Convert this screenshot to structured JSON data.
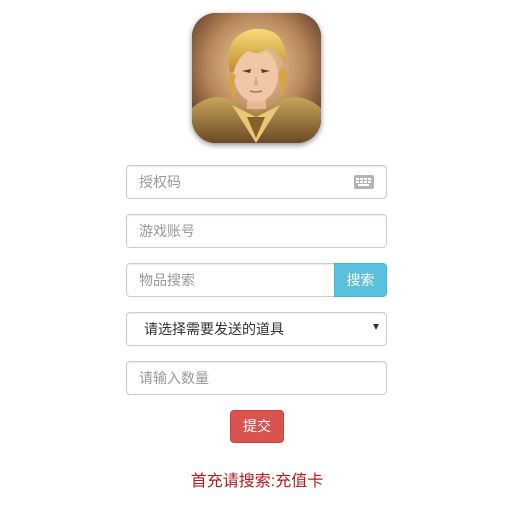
{
  "form": {
    "auth_code": {
      "placeholder": "授权码",
      "value": ""
    },
    "account": {
      "placeholder": "游戏账号",
      "value": ""
    },
    "item_search": {
      "placeholder": "物品搜索",
      "value": ""
    },
    "search_button_label": "搜索",
    "item_select": {
      "selected": "请选择需要发送的道具"
    },
    "quantity": {
      "placeholder": "请输入数量",
      "value": ""
    },
    "submit_label": "提交"
  },
  "hint_text": "首充请搜索:充值卡",
  "icons": {
    "avatar": "hero-avatar-image",
    "keyboard": "keyboard-icon",
    "select_arrow": "chevron-down-icon"
  },
  "colors": {
    "search_button": "#5bc0de",
    "submit_button": "#d9534f",
    "hint": "#b81c1c"
  }
}
